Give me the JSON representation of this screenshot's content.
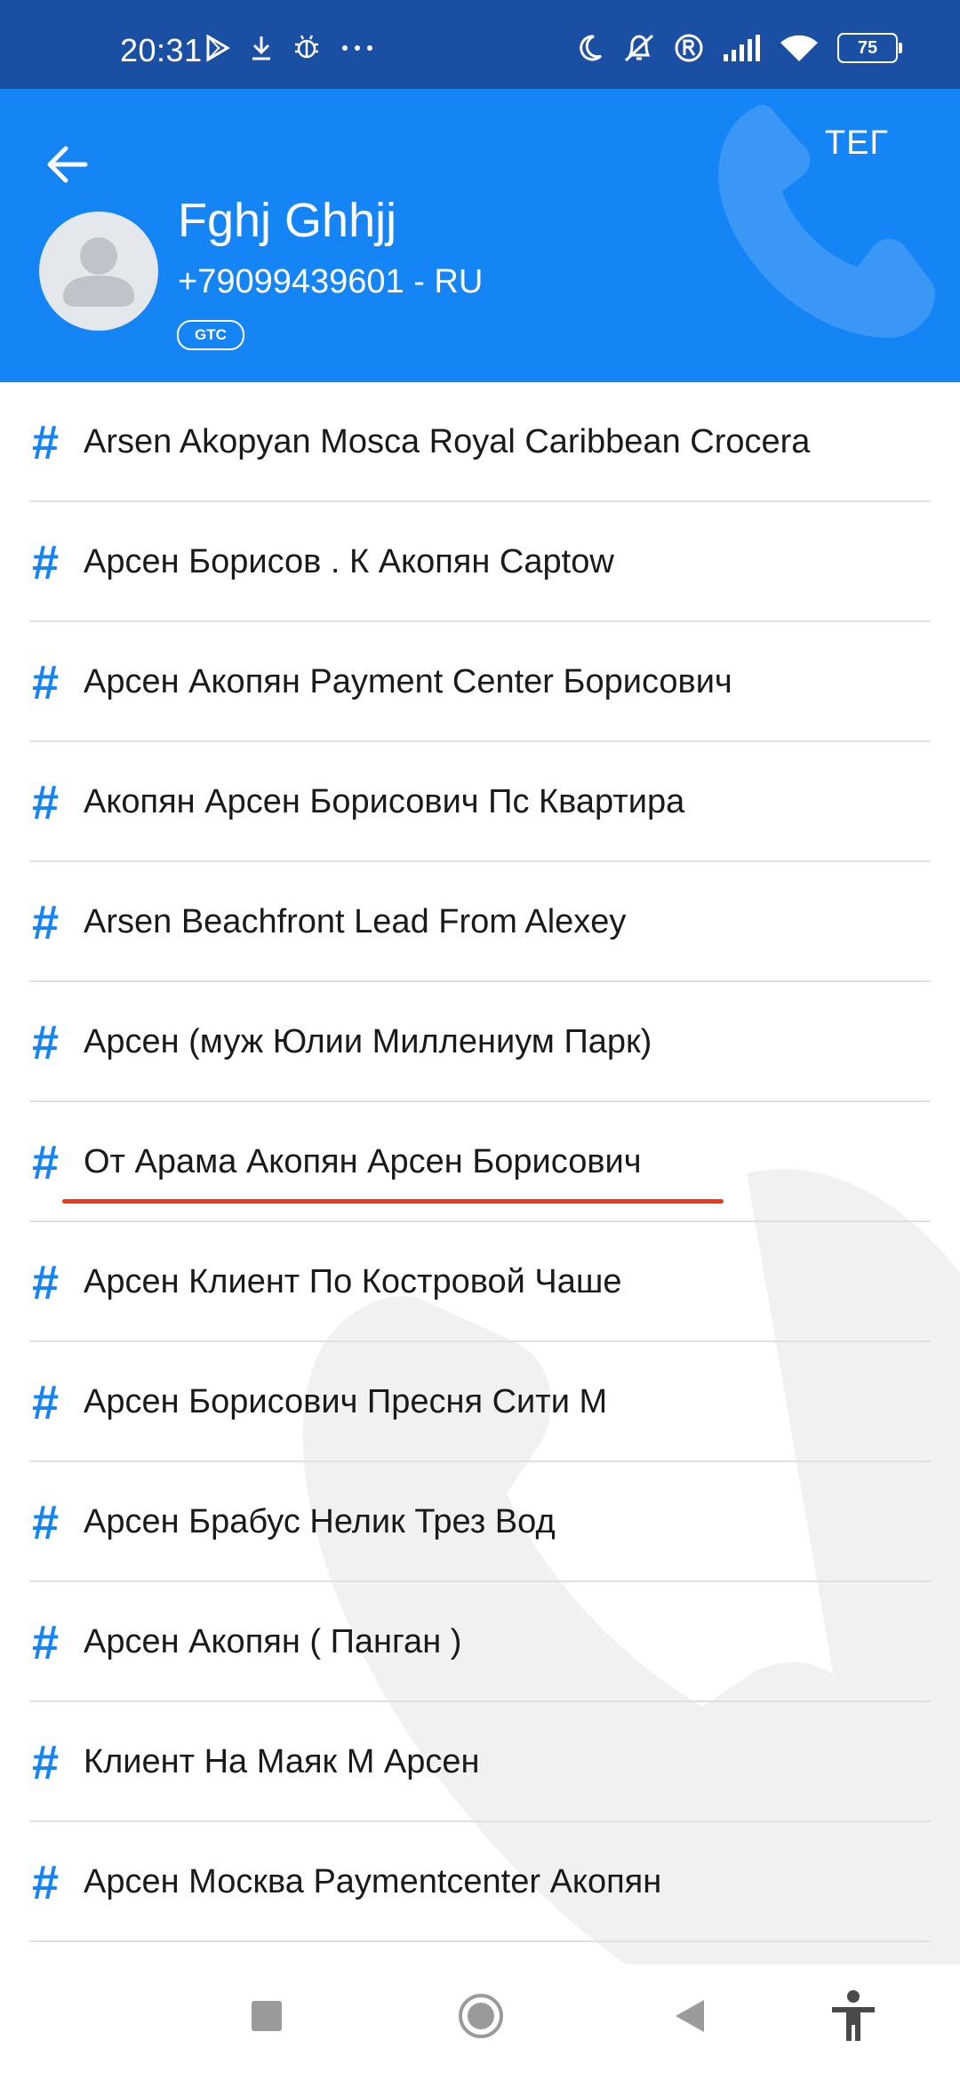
{
  "status_bar": {
    "time": "20:31",
    "left_icons": [
      "play-store-icon",
      "download-icon",
      "bug-icon",
      "more-icon"
    ],
    "right_icons": [
      "moon-icon",
      "mute-icon",
      "r-icon",
      "signal-icon",
      "wifi-icon"
    ],
    "battery": "75"
  },
  "header": {
    "tag_button": "ТЕГ",
    "name": "Fghj Ghhjj",
    "phone": "+79099439601 - RU",
    "carrier": "GTC",
    "color": "#1584f5"
  },
  "tags": [
    "Arsen Akopyan Mosca Royal Caribbean Crocera",
    "Арсен Борисов . К Акопян Captow",
    "Арсен Акопян Payment Center Борисович",
    "Акопян Арсен Борисович Пс Квартира",
    "Arsen Beachfront Lead From Alexey",
    "Арсен (муж Юлии Миллениум Парк)",
    "От Арама Акопян Арсен Борисович",
    "Арсен Клиент По Костровой Чаше",
    "Арсен Борисович Пресня Сити М",
    "Арсен Брабус Нелик Трез Вод",
    "Арсен Акопян ( Панган )",
    "Клиент На Маяк М Арсен",
    "Арсен Москва Paymentcenter Акопян"
  ],
  "highlight_color": "#f03a17",
  "nav": [
    "square-icon",
    "home-circle-icon",
    "back-triangle-icon",
    "accessibility-icon"
  ]
}
